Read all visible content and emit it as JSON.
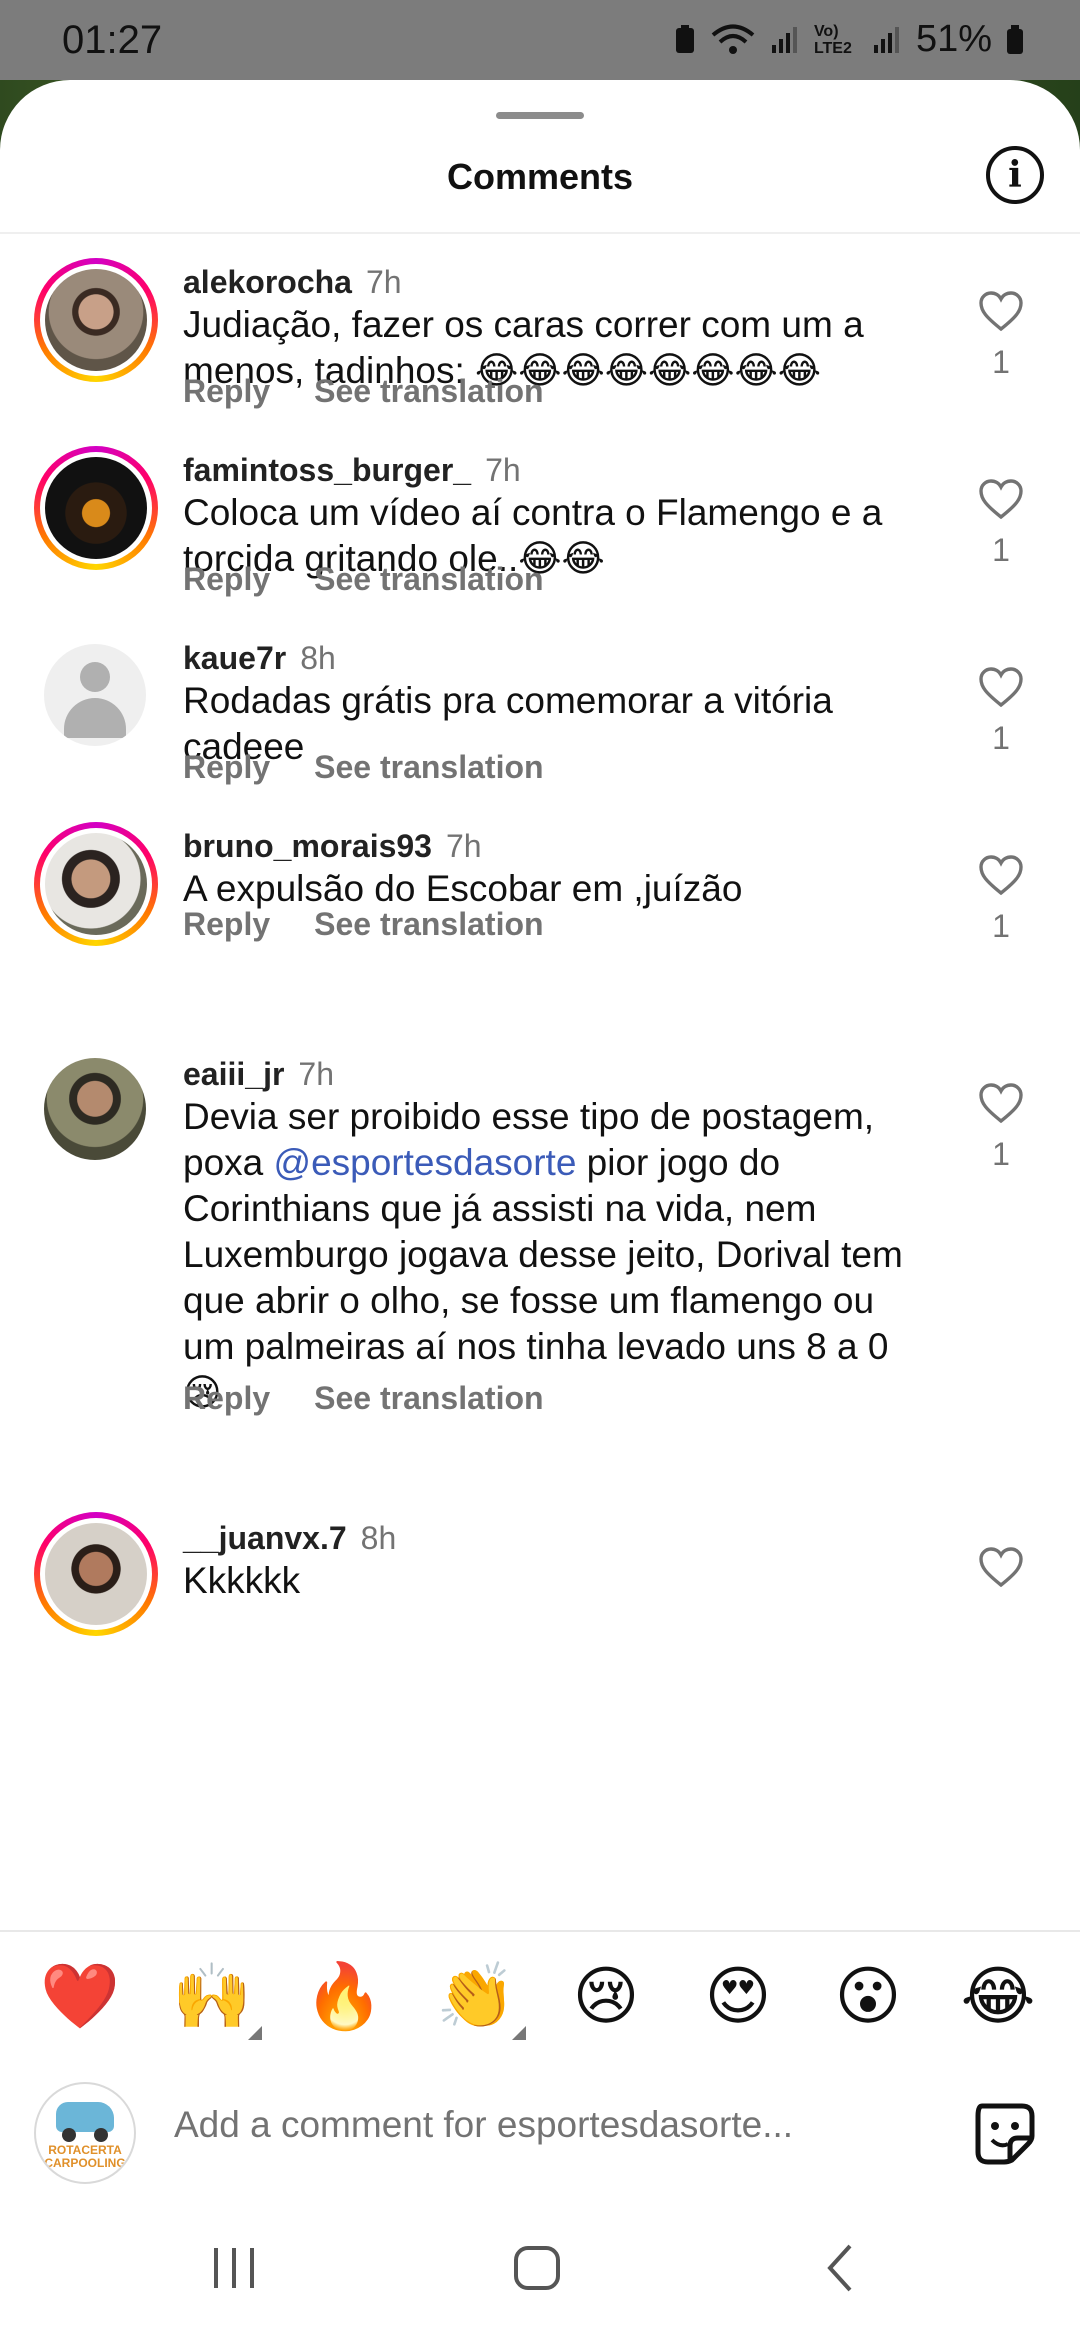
{
  "status_bar": {
    "time": "01:27",
    "battery": "51%",
    "network": "Vo) LTE2"
  },
  "header": {
    "title": "Comments",
    "info_icon": "info-icon"
  },
  "comments": [
    {
      "user": "alekorocha",
      "ago": "7h",
      "text": "Judiação, fazer os caras correr com um a menos, tadinhos: 😂😂😂😂😂😂😂😂",
      "likes": "1",
      "reply": "Reply",
      "translate": "See translation"
    },
    {
      "user": "famintoss_burger_",
      "ago": "7h",
      "text": "Coloca um vídeo aí contra o Flamengo e a torcida gritando ole..😂😂",
      "likes": "1",
      "reply": "Reply",
      "translate": "See translation"
    },
    {
      "user": "kaue7r",
      "ago": "8h",
      "text": "Rodadas grátis pra comemorar a vitória cadeee",
      "likes": "1",
      "reply": "Reply",
      "translate": "See translation"
    },
    {
      "user": "bruno_morais93",
      "ago": "7h",
      "text": "A expulsão do Escobar em ,juízão",
      "likes": "1",
      "reply": "Reply",
      "translate": "See translation"
    },
    {
      "user": "eaiii_jr",
      "ago": "7h",
      "text_before": "Devia ser proibido esse tipo de postagem, poxa ",
      "mention": "@esportesdasorte",
      "text_after": " pior jogo do Corinthians que já assisti na vida, nem Luxemburgo jogava desse jeito, Dorival tem que abrir o olho, se fosse um flamengo ou um palmeiras aí nos tinha levado uns 8 a 0 😢",
      "likes": "1",
      "reply": "Reply",
      "translate": "See translation"
    },
    {
      "user": "__juanvx.7",
      "ago": "8h",
      "text": "Kkkkkk"
    }
  ],
  "reactions": [
    "❤️",
    "🙌",
    "🔥",
    "👏",
    "😢",
    "😍",
    "😮",
    "😂"
  ],
  "composer": {
    "placeholder": "Add a comment for esportesdasorte...",
    "avatar_text": "ROTACERTA CARPOOLING"
  }
}
